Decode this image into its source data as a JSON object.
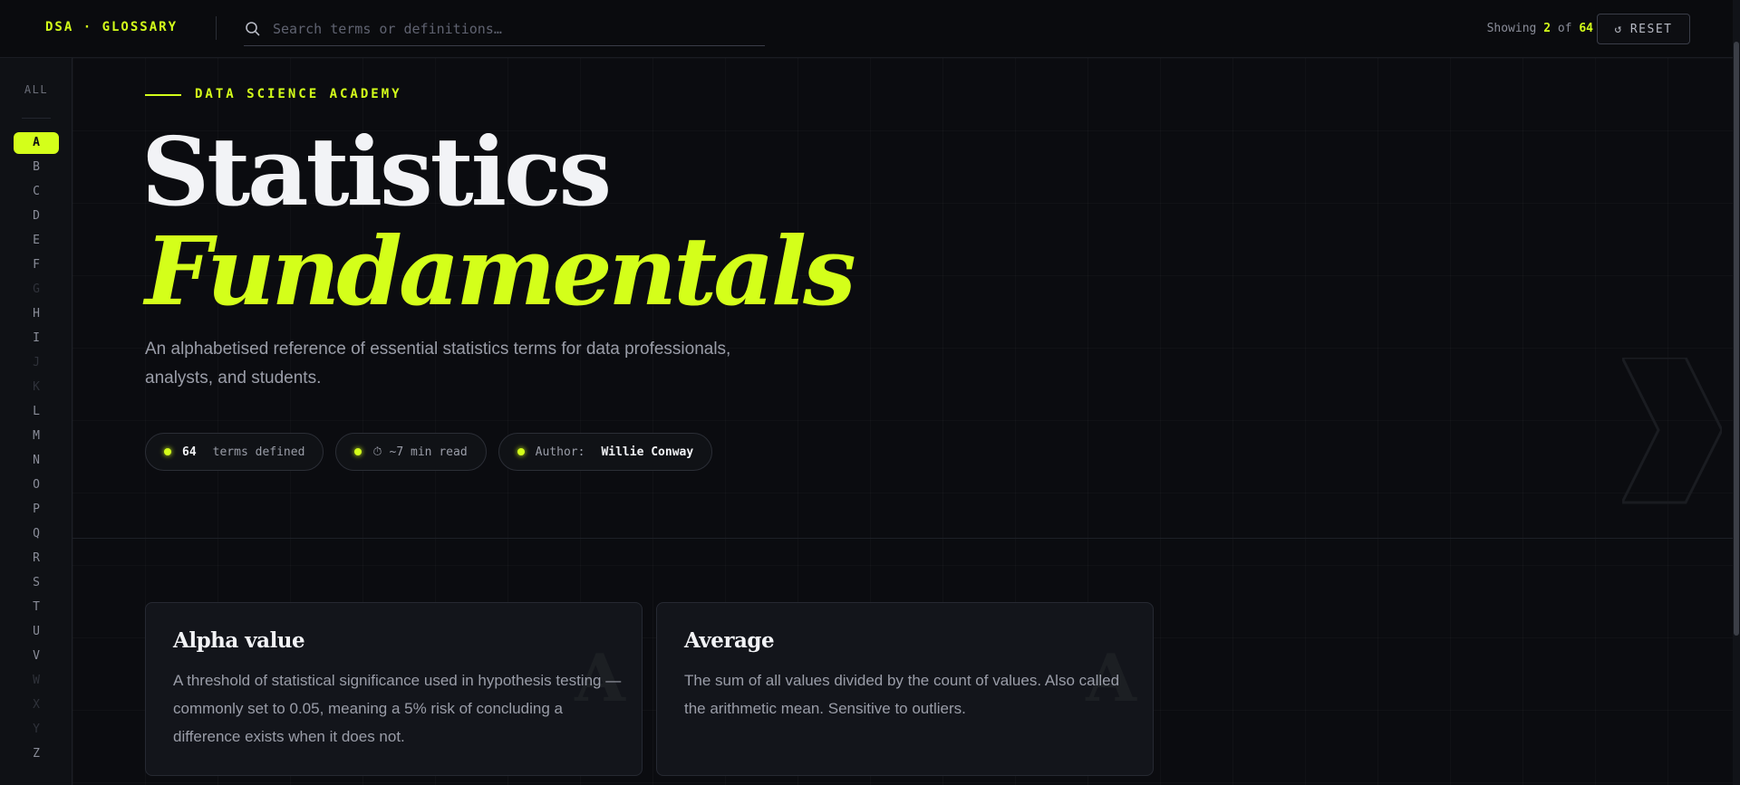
{
  "header": {
    "brand": "DSA · GLOSSARY",
    "search_placeholder": "Search terms or definitions…",
    "showing_prefix": "Showing",
    "showing_count": "2",
    "showing_of": "of",
    "showing_total": "64",
    "reset_icon": "↺",
    "reset_label": "RESET"
  },
  "sidebar": {
    "all_label": "ALL",
    "letters": [
      {
        "letter": "A",
        "state": "active"
      },
      {
        "letter": "B",
        "state": "enabled"
      },
      {
        "letter": "C",
        "state": "enabled"
      },
      {
        "letter": "D",
        "state": "enabled"
      },
      {
        "letter": "E",
        "state": "enabled"
      },
      {
        "letter": "F",
        "state": "enabled"
      },
      {
        "letter": "G",
        "state": "disabled"
      },
      {
        "letter": "H",
        "state": "enabled"
      },
      {
        "letter": "I",
        "state": "enabled"
      },
      {
        "letter": "J",
        "state": "disabled"
      },
      {
        "letter": "K",
        "state": "disabled"
      },
      {
        "letter": "L",
        "state": "enabled"
      },
      {
        "letter": "M",
        "state": "enabled"
      },
      {
        "letter": "N",
        "state": "enabled"
      },
      {
        "letter": "O",
        "state": "enabled"
      },
      {
        "letter": "P",
        "state": "enabled"
      },
      {
        "letter": "Q",
        "state": "enabled"
      },
      {
        "letter": "R",
        "state": "enabled"
      },
      {
        "letter": "S",
        "state": "enabled"
      },
      {
        "letter": "T",
        "state": "enabled"
      },
      {
        "letter": "U",
        "state": "enabled"
      },
      {
        "letter": "V",
        "state": "enabled"
      },
      {
        "letter": "W",
        "state": "disabled"
      },
      {
        "letter": "X",
        "state": "disabled"
      },
      {
        "letter": "Y",
        "state": "disabled"
      },
      {
        "letter": "Z",
        "state": "enabled"
      }
    ]
  },
  "hero": {
    "eyebrow": "DATA SCIENCE ACADEMY",
    "title_line1": "Statistics",
    "title_line2": "Fundamentals",
    "description": "An alphabetised reference of essential statistics terms for data professionals, analysts, and students.",
    "pills": {
      "terms_count": "64",
      "terms_label": "terms defined",
      "read_icon": "⏱",
      "read_label": "~7 min read",
      "author_label": "Author:",
      "author_name": "Willie Conway"
    }
  },
  "cards": [
    {
      "letter": "A",
      "title": "Alpha value",
      "definition": "A threshold of statistical significance used in hypothesis testing — commonly set to 0.05, meaning a 5% risk of concluding a difference exists when it does not."
    },
    {
      "letter": "A",
      "title": "Average",
      "definition": "The sum of all values divided by the count of values. Also called the arithmetic mean. Sensitive to outliers."
    }
  ],
  "colors": {
    "accent": "#d4ff1a",
    "background": "#0b0c10",
    "card_bg": "#13151b",
    "muted_text": "#9a9da8"
  }
}
